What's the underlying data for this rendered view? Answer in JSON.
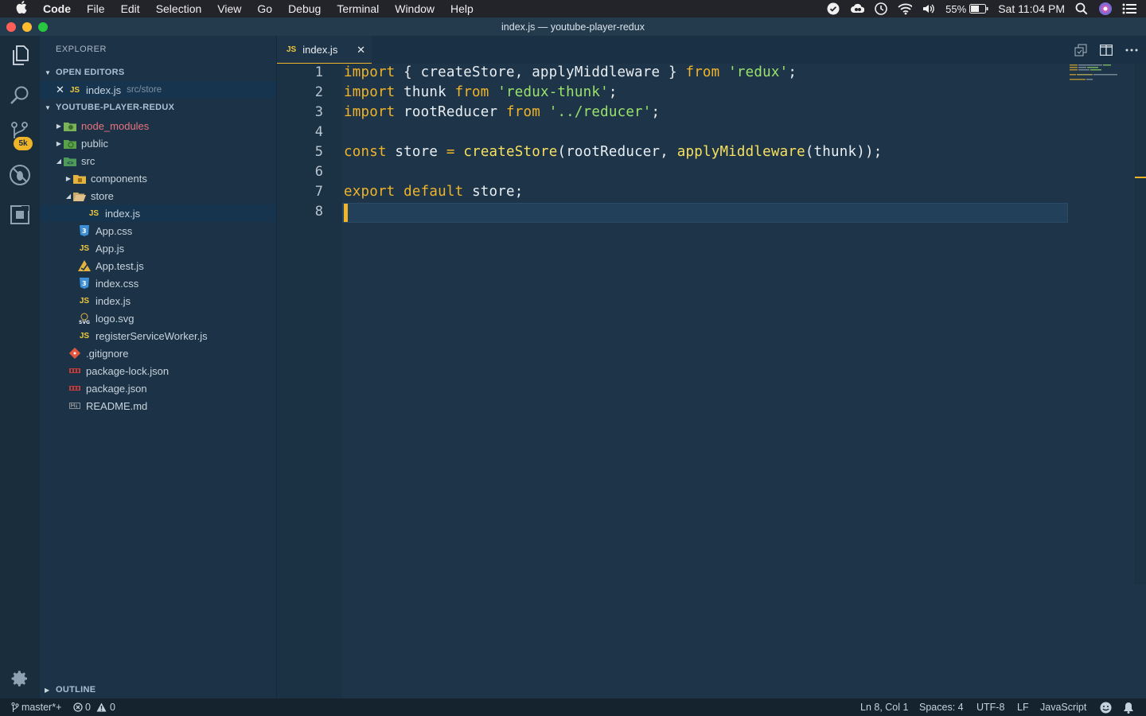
{
  "menubar": {
    "app": "Code",
    "items": [
      "File",
      "Edit",
      "Selection",
      "View",
      "Go",
      "Debug",
      "Terminal",
      "Window",
      "Help"
    ],
    "battery": "55%",
    "clock": "Sat 11:04 PM"
  },
  "window": {
    "title": "index.js — youtube-player-redux"
  },
  "activity": {
    "scm_badge": "5k"
  },
  "sidebar": {
    "title": "EXPLORER",
    "open_editors_header": "OPEN EDITORS",
    "open_editor": {
      "name": "index.js",
      "path": "src/store",
      "type": "JS"
    },
    "project_header": "YOUTUBE-PLAYER-REDUX",
    "tree": [
      {
        "label": "node_modules",
        "kind": "folder-node"
      },
      {
        "label": "public",
        "kind": "folder-public"
      },
      {
        "label": "src",
        "kind": "folder-src"
      },
      {
        "label": "components",
        "kind": "folder"
      },
      {
        "label": "store",
        "kind": "folder-open"
      },
      {
        "label": "index.js",
        "kind": "js"
      },
      {
        "label": "App.css",
        "kind": "css"
      },
      {
        "label": "App.js",
        "kind": "js"
      },
      {
        "label": "App.test.js",
        "kind": "test"
      },
      {
        "label": "index.css",
        "kind": "css"
      },
      {
        "label": "index.js",
        "kind": "js"
      },
      {
        "label": "logo.svg",
        "kind": "svg"
      },
      {
        "label": "registerServiceWorker.js",
        "kind": "js"
      },
      {
        "label": ".gitignore",
        "kind": "git"
      },
      {
        "label": "package-lock.json",
        "kind": "json"
      },
      {
        "label": "package.json",
        "kind": "json"
      },
      {
        "label": "README.md",
        "kind": "md"
      }
    ],
    "outline_header": "OUTLINE",
    "js_badge": "JS"
  },
  "editor": {
    "tab": {
      "label": "index.js",
      "type": "JS"
    },
    "line_numbers": [
      "1",
      "2",
      "3",
      "4",
      "5",
      "6",
      "7",
      "8"
    ],
    "lines": [
      [
        {
          "t": "import",
          "c": "kw"
        },
        {
          "t": " { createStore, applyMiddleware } ",
          "c": ""
        },
        {
          "t": "from",
          "c": "kw"
        },
        {
          "t": " ",
          "c": ""
        },
        {
          "t": "'redux'",
          "c": "str"
        },
        {
          "t": ";",
          "c": ""
        }
      ],
      [
        {
          "t": "import",
          "c": "kw"
        },
        {
          "t": " thunk ",
          "c": ""
        },
        {
          "t": "from",
          "c": "kw"
        },
        {
          "t": " ",
          "c": ""
        },
        {
          "t": "'redux-thunk'",
          "c": "str"
        },
        {
          "t": ";",
          "c": ""
        }
      ],
      [
        {
          "t": "import",
          "c": "kw"
        },
        {
          "t": " rootReducer ",
          "c": ""
        },
        {
          "t": "from",
          "c": "kw"
        },
        {
          "t": " ",
          "c": ""
        },
        {
          "t": "'../reducer'",
          "c": "str"
        },
        {
          "t": ";",
          "c": ""
        }
      ],
      [],
      [
        {
          "t": "const",
          "c": "kw"
        },
        {
          "t": " store ",
          "c": ""
        },
        {
          "t": "=",
          "c": "op"
        },
        {
          "t": " ",
          "c": ""
        },
        {
          "t": "createStore",
          "c": "fn"
        },
        {
          "t": "(rootReducer, ",
          "c": ""
        },
        {
          "t": "applyMiddleware",
          "c": "fn"
        },
        {
          "t": "(thunk));",
          "c": ""
        }
      ],
      [],
      [
        {
          "t": "export",
          "c": "kw"
        },
        {
          "t": " ",
          "c": ""
        },
        {
          "t": "default",
          "c": "kw"
        },
        {
          "t": " store;",
          "c": ""
        }
      ],
      []
    ]
  },
  "statusbar": {
    "branch": "master*+",
    "errors": "0",
    "warnings": "0",
    "position": "Ln 8, Col 1",
    "spaces": "Spaces: 4",
    "encoding": "UTF-8",
    "eol": "LF",
    "language": "JavaScript"
  },
  "colors": {
    "accent": "#f0b429",
    "string": "#9be36b",
    "background": "#1e3549"
  }
}
